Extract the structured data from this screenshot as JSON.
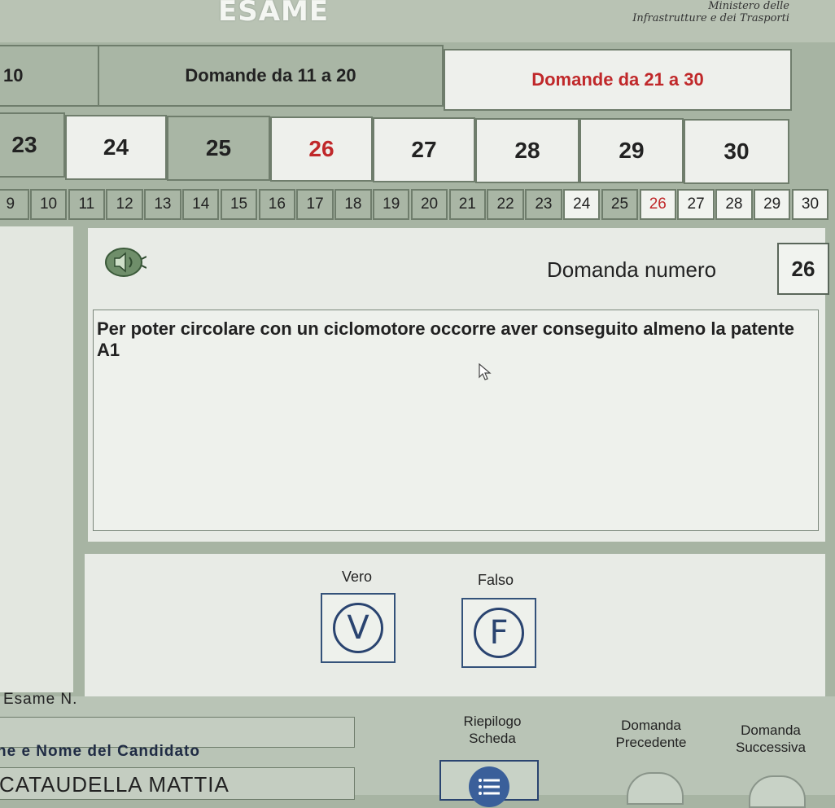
{
  "header": {
    "logo_text": "ESAME",
    "ministry_line1": "Ministero delle",
    "ministry_line2": "Infrastrutture e dei Trasporti"
  },
  "groups": {
    "prev_partial": "10",
    "group_11_20": "Domande da 11 a 20",
    "group_21_30": "Domande da 21 a 30",
    "active": "Domande da 21 a 30"
  },
  "tiles": [
    {
      "label": "23",
      "style": "gray"
    },
    {
      "label": "24",
      "style": "white"
    },
    {
      "label": "25",
      "style": "gray"
    },
    {
      "label": "26",
      "style": "white",
      "active": true
    },
    {
      "label": "27",
      "style": "white"
    },
    {
      "label": "28",
      "style": "white"
    },
    {
      "label": "29",
      "style": "white"
    },
    {
      "label": "30",
      "style": "white"
    }
  ],
  "strip": [
    {
      "label": "9",
      "style": "gray"
    },
    {
      "label": "10",
      "style": "gray"
    },
    {
      "label": "11",
      "style": "gray"
    },
    {
      "label": "12",
      "style": "gray"
    },
    {
      "label": "13",
      "style": "gray"
    },
    {
      "label": "14",
      "style": "gray"
    },
    {
      "label": "15",
      "style": "gray"
    },
    {
      "label": "16",
      "style": "gray"
    },
    {
      "label": "17",
      "style": "gray"
    },
    {
      "label": "18",
      "style": "gray"
    },
    {
      "label": "19",
      "style": "gray"
    },
    {
      "label": "20",
      "style": "gray"
    },
    {
      "label": "21",
      "style": "gray"
    },
    {
      "label": "22",
      "style": "gray"
    },
    {
      "label": "23",
      "style": "gray"
    },
    {
      "label": "24",
      "style": "white"
    },
    {
      "label": "25",
      "style": "gray"
    },
    {
      "label": "26",
      "style": "white",
      "active": true
    },
    {
      "label": "27",
      "style": "white"
    },
    {
      "label": "28",
      "style": "white"
    },
    {
      "label": "29",
      "style": "white"
    },
    {
      "label": "30",
      "style": "white"
    }
  ],
  "question": {
    "label": "Domanda numero",
    "number": "26",
    "text": "Per poter circolare con un ciclomotore occorre aver conseguito almeno la patente A1"
  },
  "answers": {
    "vero_label": "Vero",
    "vero_glyph": "V",
    "falso_label": "Falso",
    "falso_glyph": "F"
  },
  "footer": {
    "exam_n_label": "Esame N.",
    "exam_n_value": "",
    "candidate_label": "ne e Nome del Candidato",
    "candidate_value": "CATAUDELLA MATTIA",
    "riepilogo_label": "Riepilogo Scheda",
    "precedente_label": "Domanda Precedente",
    "successiva_label": "Domanda Successiva"
  },
  "colors": {
    "active_red": "#c0282a",
    "tile_gray": "#a9b6a5",
    "tile_white": "#eef0ec",
    "accent_blue": "#2a4470"
  },
  "icons": {
    "audio": "speaker-icon",
    "riepilogo": "list-icon",
    "cursor": "mouse-pointer-icon"
  }
}
